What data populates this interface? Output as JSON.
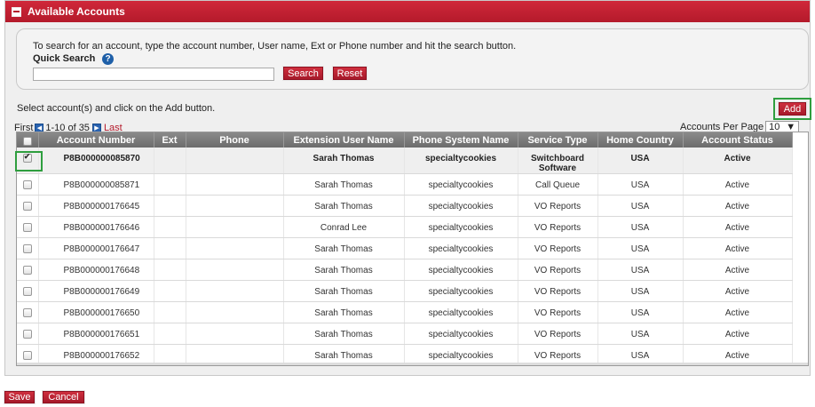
{
  "panel": {
    "title": "Available Accounts"
  },
  "search": {
    "instructions": "To search for an account, type the account number, User name, Ext or Phone number and hit the search button.",
    "quick_label": "Quick Search",
    "help_glyph": "?",
    "value": "",
    "placeholder": "",
    "search_label": "Search",
    "reset_label": "Reset"
  },
  "select_instructions": "Select account(s) and click on the Add button.",
  "add_label": "Add",
  "pager": {
    "first": "First",
    "range": "1-10 of 35",
    "last": "Last",
    "prev_glyph": "◀",
    "next_glyph": "▶"
  },
  "per_page": {
    "label": "Accounts Per Page",
    "value": "10",
    "arrow": "▼"
  },
  "columns": [
    "Account Number",
    "Ext",
    "Phone",
    "Extension User Name",
    "Phone System Name",
    "Service Type",
    "Home Country",
    "Account Status"
  ],
  "rows": [
    {
      "account": "P8B000000085870",
      "ext": "",
      "phone": "",
      "user": "Sarah Thomas",
      "system": "specialtycookies",
      "service": "Switchboard Software",
      "country": "USA",
      "status": "Active",
      "checked": true
    },
    {
      "account": "P8B000000085871",
      "ext": "",
      "phone": "",
      "user": "Sarah Thomas",
      "system": "specialtycookies",
      "service": "Call Queue",
      "country": "USA",
      "status": "Active",
      "checked": false
    },
    {
      "account": "P8B000000176645",
      "ext": "",
      "phone": "",
      "user": "Sarah Thomas",
      "system": "specialtycookies",
      "service": "VO Reports",
      "country": "USA",
      "status": "Active",
      "checked": false
    },
    {
      "account": "P8B000000176646",
      "ext": "",
      "phone": "",
      "user": "Conrad Lee",
      "system": "specialtycookies",
      "service": "VO Reports",
      "country": "USA",
      "status": "Active",
      "checked": false
    },
    {
      "account": "P8B000000176647",
      "ext": "",
      "phone": "",
      "user": "Sarah Thomas",
      "system": "specialtycookies",
      "service": "VO Reports",
      "country": "USA",
      "status": "Active",
      "checked": false
    },
    {
      "account": "P8B000000176648",
      "ext": "",
      "phone": "",
      "user": "Sarah Thomas",
      "system": "specialtycookies",
      "service": "VO Reports",
      "country": "USA",
      "status": "Active",
      "checked": false
    },
    {
      "account": "P8B000000176649",
      "ext": "",
      "phone": "",
      "user": "Sarah Thomas",
      "system": "specialtycookies",
      "service": "VO Reports",
      "country": "USA",
      "status": "Active",
      "checked": false
    },
    {
      "account": "P8B000000176650",
      "ext": "",
      "phone": "",
      "user": "Sarah Thomas",
      "system": "specialtycookies",
      "service": "VO Reports",
      "country": "USA",
      "status": "Active",
      "checked": false
    },
    {
      "account": "P8B000000176651",
      "ext": "",
      "phone": "",
      "user": "Sarah Thomas",
      "system": "specialtycookies",
      "service": "VO Reports",
      "country": "USA",
      "status": "Active",
      "checked": false
    },
    {
      "account": "P8B000000176652",
      "ext": "",
      "phone": "",
      "user": "Sarah Thomas",
      "system": "specialtycookies",
      "service": "VO Reports",
      "country": "USA",
      "status": "Active",
      "checked": false
    }
  ],
  "footer": {
    "save_label": "Save",
    "cancel_label": "Cancel"
  },
  "colors": {
    "brand_red": "#b41a2b",
    "highlight_green": "#2e9e3e",
    "link_blue": "#2a63b0"
  }
}
